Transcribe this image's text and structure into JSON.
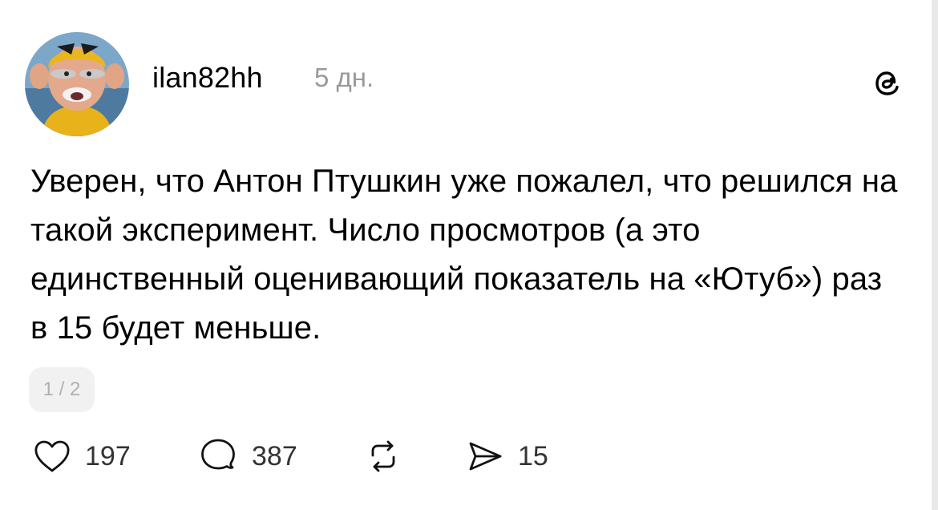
{
  "post": {
    "username": "ilan82hh",
    "time": "5 дн.",
    "text": "Уверен, что Антон Птушкин уже пожалел, что решился на такой эксперимент. Число просмотров (а это единственный оценивающий показатель на «Ютуб») раз в 15 будет меньше.",
    "page_indicator": "1 / 2"
  },
  "actions": {
    "likes": "197",
    "comments": "387",
    "shares": "15"
  },
  "icons": {
    "brand": "threads-logo-icon",
    "like": "heart-icon",
    "comment": "comment-bubble-icon",
    "repost": "repost-icon",
    "share": "send-icon"
  }
}
